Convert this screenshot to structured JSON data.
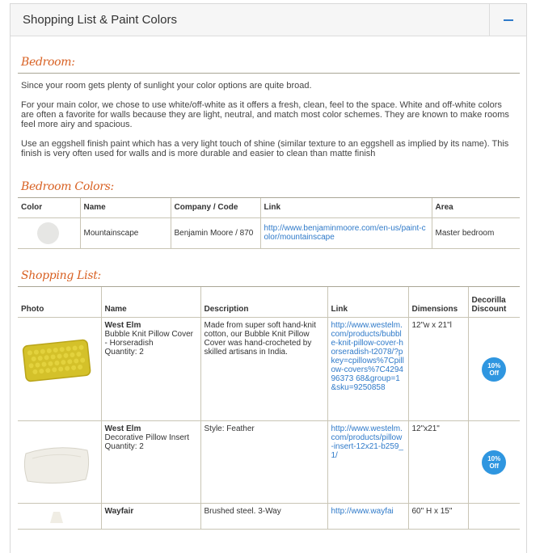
{
  "panel": {
    "title": "Shopping List & Paint Colors"
  },
  "bedroom": {
    "heading": "Bedroom:",
    "paragraphs": [
      "Since your room gets plenty of sunlight your color options are quite broad.",
      "For your main color, we chose to use white/off-white as it offers a fresh, clean, feel to the space. White and off-white colors are often a favorite for walls because they are light, neutral, and match most color schemes. They are known to make rooms feel more airy and spacious.",
      "Use an eggshell finish paint which has a very light touch of shine (similar texture to an eggshell as implied by its name). This finish is very often used for walls and is more durable and easier to clean than matte finish"
    ]
  },
  "colors": {
    "heading": "Bedroom Colors:",
    "headers": [
      "Color",
      "Name",
      "Company / Code",
      "Link",
      "Area"
    ],
    "rows": [
      {
        "swatch_color": "#e6e6e4",
        "name": "Mountainscape",
        "company": "Benjamin Moore / 870",
        "link": "http://www.benjaminmoore.com/en-us/paint-color/mountainscape",
        "area": "Master bedroom"
      }
    ]
  },
  "shopping": {
    "heading": "Shopping List:",
    "headers": [
      "Photo",
      "Name",
      "Description",
      "Link",
      "Dimensions",
      "Decorilla Discount"
    ],
    "rows": [
      {
        "brand": "West Elm",
        "product": "Bubble Knit Pillow Cover - Horseradish",
        "quantity": "Quantity: 2",
        "description": "Made from super soft hand-knit cotton, our Bubble Knit Pillow Cover was hand-crocheted by skilled artisans in India.",
        "link": "http://www.westelm.com/products/bubble-knit-pillow-cover-horseradish-t2078/?pkey=cpillows%7Cpillow-covers%7C429496373 68&group=1&sku=9250858",
        "dimensions": "12\"w x 21\"l",
        "discount_pct": "10%",
        "discount_word": "Off"
      },
      {
        "brand": "West Elm",
        "product": "Decorative Pillow Insert",
        "quantity": "Quantity: 2",
        "description": "Style: Feather",
        "link": "http://www.westelm.com/products/pillow-insert-12x21-b259_1/",
        "dimensions": "12\"x21\"",
        "discount_pct": "10%",
        "discount_word": "Off"
      },
      {
        "brand": "Wayfair",
        "product": "",
        "quantity": "",
        "description": "Brushed steel. 3-Way",
        "link": "http://www.wayfai",
        "dimensions": "60\" H x 15\"",
        "discount_pct": "",
        "discount_word": ""
      }
    ]
  },
  "colors_theme": {
    "heading_orange": "#d86022",
    "link_blue": "#2f7ac9",
    "badge_blue": "#2f96e0"
  }
}
